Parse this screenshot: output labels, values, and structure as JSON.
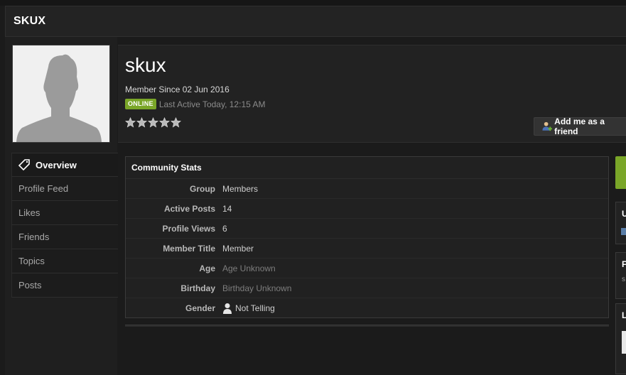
{
  "page": {
    "title": "SKUX"
  },
  "profile": {
    "username": "skux",
    "member_since": "Member Since 02 Jun 2016",
    "status_badge": "ONLINE",
    "last_active": "Last Active Today, 12:15 AM",
    "rating_stars": 5,
    "rating_filled": 0,
    "add_friend_label": "Add me as a friend"
  },
  "sidenav": {
    "items": [
      {
        "label": "Overview",
        "active": true
      },
      {
        "label": "Profile Feed"
      },
      {
        "label": "Likes"
      },
      {
        "label": "Friends"
      },
      {
        "label": "Topics"
      },
      {
        "label": "Posts"
      }
    ]
  },
  "stats": {
    "title": "Community Stats",
    "rows": [
      {
        "label": "Group",
        "value": "Members"
      },
      {
        "label": "Active Posts",
        "value": "14"
      },
      {
        "label": "Profile Views",
        "value": "6"
      },
      {
        "label": "Member Title",
        "value": "Member"
      },
      {
        "label": "Age",
        "value": "Age Unknown",
        "muted": true
      },
      {
        "label": "Birthday",
        "value": "Birthday Unknown",
        "muted": true
      },
      {
        "label": "Gender",
        "value": "Not Telling"
      }
    ]
  },
  "right_col": {
    "boxes": [
      {
        "initial": "U"
      },
      {
        "initial": "F",
        "sub": "s"
      },
      {
        "initial": "L"
      }
    ]
  },
  "colors": {
    "accent_green": "#7aa628",
    "background": "#1b1b1b",
    "panel": "#222222"
  }
}
